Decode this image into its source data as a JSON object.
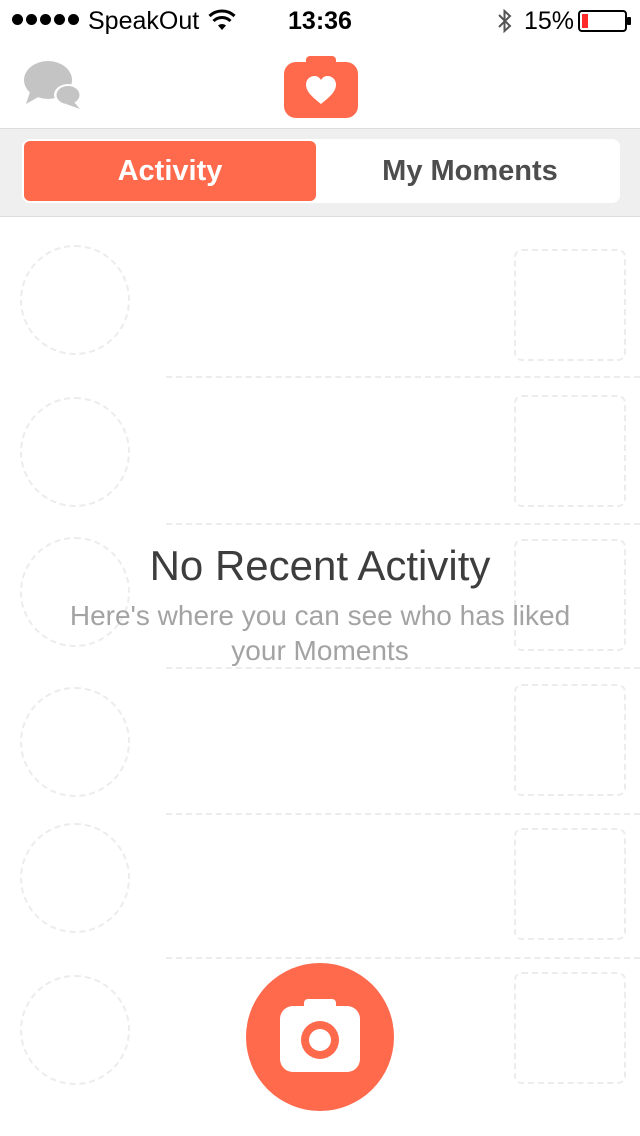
{
  "status_bar": {
    "carrier": "SpeakOut",
    "time": "13:36",
    "battery": "15%"
  },
  "nav": {
    "left_icon": "chat-bubbles-icon",
    "logo_icon": "camera-heart-icon"
  },
  "tabs": [
    {
      "label": "Activity",
      "selected": true
    },
    {
      "label": "My Moments",
      "selected": false
    }
  ],
  "empty_state": {
    "title": "No Recent Activity",
    "subtitle": "Here's where you can see who has liked your Moments"
  },
  "capture_button": {
    "icon": "camera-icon"
  },
  "colors": {
    "accent": "#ff6a4d",
    "text_dark": "#3d3d3d",
    "text_muted": "#a3a3a3",
    "segment_background": "#efefef"
  }
}
